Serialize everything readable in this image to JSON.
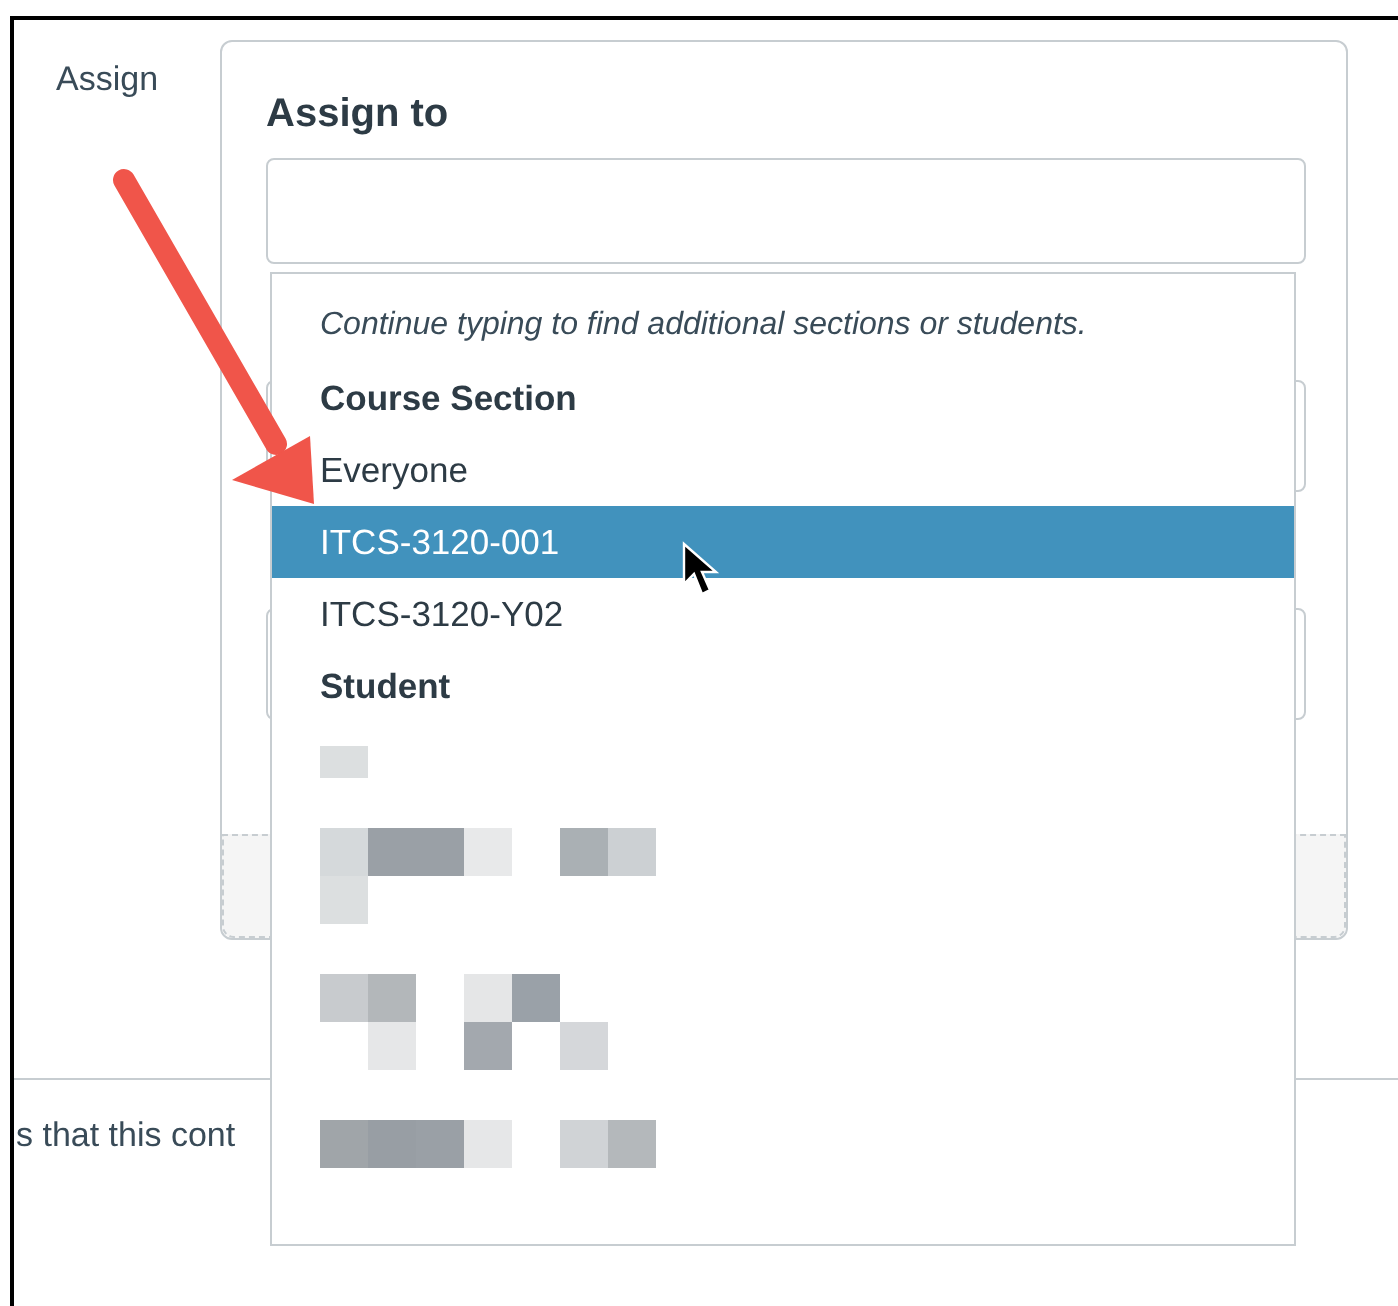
{
  "field_label": "Assign",
  "assign_to": {
    "title": "Assign to"
  },
  "dropdown": {
    "hint": "Continue typing to find additional sections or students.",
    "groups": [
      {
        "heading": "Course Section",
        "options": [
          {
            "kind": "text",
            "label": "Everyone",
            "selected": false
          },
          {
            "kind": "text",
            "label": "ITCS-3120-001",
            "selected": true
          },
          {
            "kind": "text",
            "label": "ITCS-3120-Y02",
            "selected": false
          }
        ]
      },
      {
        "heading": "Student",
        "options": [
          {
            "kind": "redacted",
            "selected": false
          },
          {
            "kind": "redacted",
            "selected": false
          },
          {
            "kind": "redacted",
            "selected": false
          },
          {
            "kind": "redacted",
            "selected": false
          }
        ]
      }
    ]
  },
  "footer_text": "s that this cont"
}
